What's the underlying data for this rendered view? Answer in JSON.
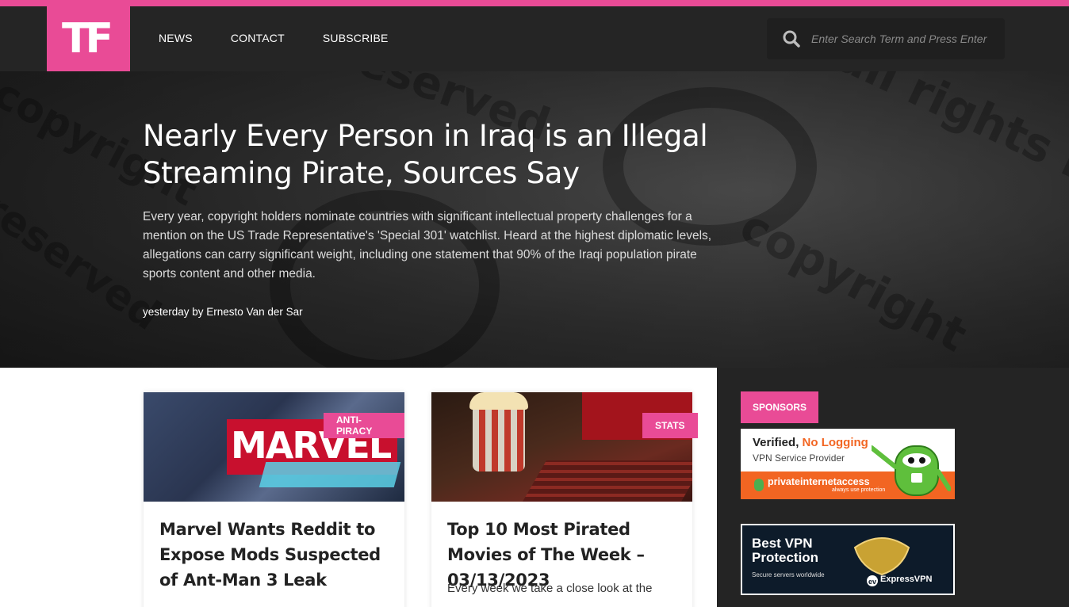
{
  "header": {
    "logo_text": "TF",
    "nav": [
      {
        "label": "NEWS"
      },
      {
        "label": "CONTACT"
      },
      {
        "label": "SUBSCRIBE"
      }
    ],
    "search": {
      "placeholder": "Enter Search Term and Press Enter",
      "value": ""
    }
  },
  "hero": {
    "title": "Nearly Every Person in Iraq is an Illegal Streaming Pirate, Sources Say",
    "excerpt": "Every year, copyright holders nominate countries with significant intellectual property challenges for a mention on the US Trade Representative's 'Special 301' watchlist. Heard at the highest diplomatic levels, allegations can carry significant weight, including one statement that 90% of the Iraqi population pirate sports content and other media.",
    "meta": "yesterday by Ernesto Van der Sar"
  },
  "cards": [
    {
      "category": "ANTI-PIRACY",
      "title": "Marvel Wants Reddit to Expose Mods Suspected of Ant-Man 3 Leak",
      "excerpt": "",
      "thumb_text": "MARVEL"
    },
    {
      "category": "STATS",
      "title": "Top 10 Most Pirated Movies of The Week – 03/13/2023",
      "excerpt": "Every week we take a close look at the"
    }
  ],
  "sidebar": {
    "label": "SPONSORS",
    "ad_pia": {
      "line1_a": "Verified,",
      "line1_b": "No Logging",
      "line2": "VPN Service Provider",
      "brand": "privateinternetaccess",
      "tagline": "always use protection"
    },
    "ad_expressvpn": {
      "title": "Best VPN Protection",
      "subtitle": "Secure servers worldwide",
      "brand": "ExpressVPN"
    }
  },
  "colors": {
    "accent": "#e94b96",
    "header_bg": "#252525",
    "sidebar_bg": "#242424"
  }
}
